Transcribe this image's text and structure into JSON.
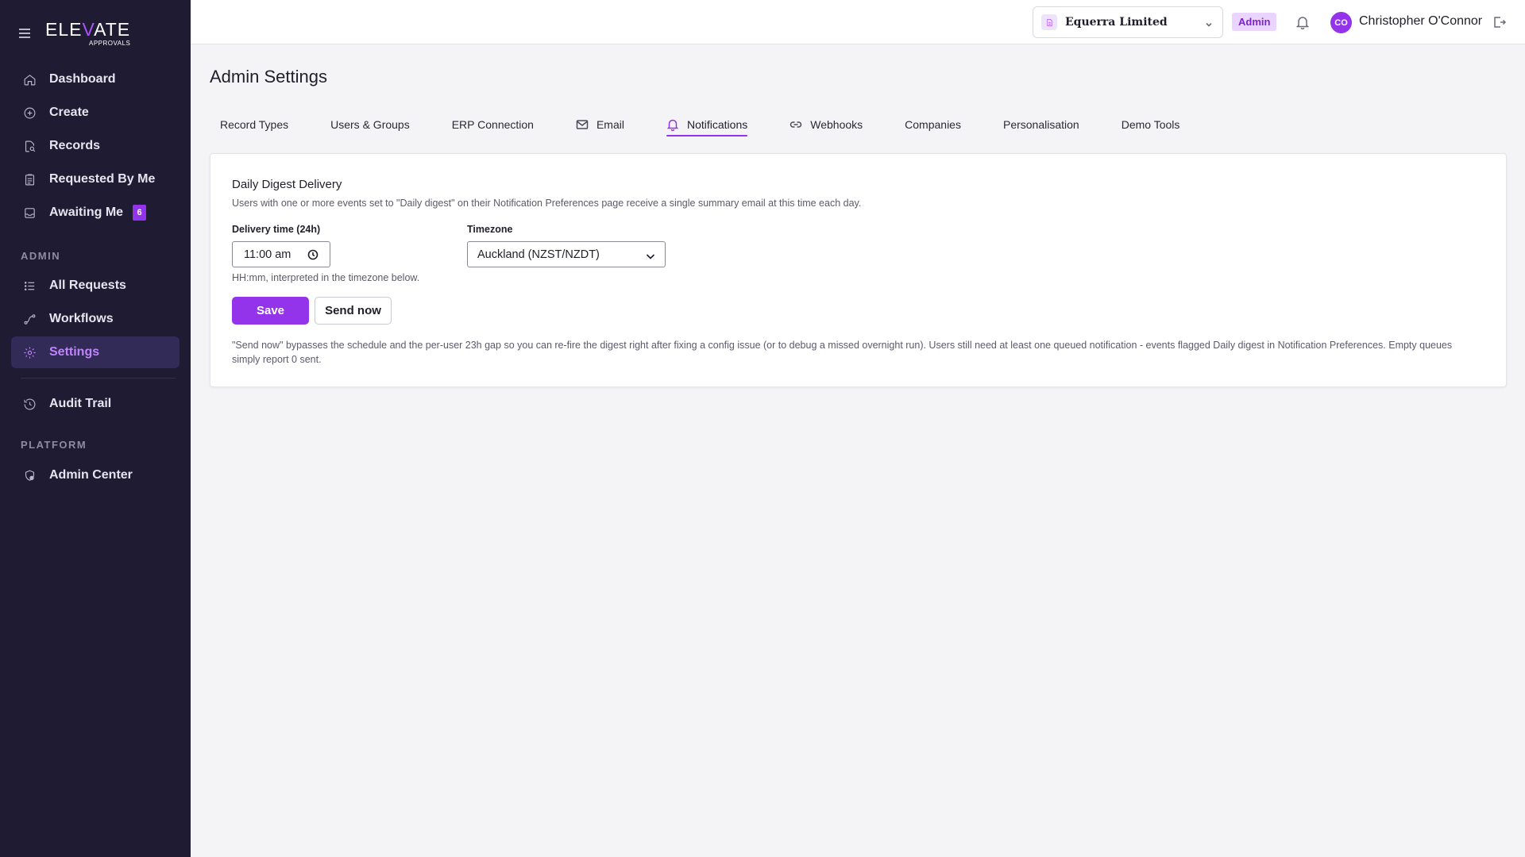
{
  "app": {
    "logo_text_1": "ELE",
    "logo_text_accent": "V",
    "logo_text_2": "ATE",
    "logo_sub": "APPROVALS"
  },
  "sidebar": {
    "items_main": [
      {
        "label": "Dashboard",
        "icon": "home-icon"
      },
      {
        "label": "Create",
        "icon": "plus-circle-icon"
      },
      {
        "label": "Records",
        "icon": "document-search-icon"
      },
      {
        "label": "Requested By Me",
        "icon": "clipboard-icon"
      },
      {
        "label": "Awaiting Me",
        "icon": "inbox-icon",
        "badge": "6"
      }
    ],
    "admin_label": "ADMIN",
    "items_admin": [
      {
        "label": "All Requests",
        "icon": "list-icon"
      },
      {
        "label": "Workflows",
        "icon": "workflow-icon"
      },
      {
        "label": "Settings",
        "icon": "gear-icon",
        "active": true
      }
    ],
    "audit": {
      "label": "Audit Trail",
      "icon": "history-icon"
    },
    "platform_label": "PLATFORM",
    "items_platform": [
      {
        "label": "Admin Center",
        "icon": "shield-settings-icon"
      }
    ]
  },
  "topbar": {
    "company": "Equerra Limited",
    "role": "Admin",
    "user_initials": "CO",
    "user_name": "Christopher O'Connor"
  },
  "page": {
    "title": "Admin Settings",
    "tabs": [
      {
        "label": "Record Types"
      },
      {
        "label": "Users & Groups"
      },
      {
        "label": "ERP Connection"
      },
      {
        "label": "Email",
        "icon": "mail-icon"
      },
      {
        "label": "Notifications",
        "icon": "bell-icon",
        "active": true
      },
      {
        "label": "Webhooks",
        "icon": "link-icon"
      },
      {
        "label": "Companies"
      },
      {
        "label": "Personalisation"
      },
      {
        "label": "Demo Tools"
      }
    ]
  },
  "digest": {
    "title": "Daily Digest Delivery",
    "description": "Users with one or more events set to \"Daily digest\" on their Notification Preferences page receive a single summary email at this time each day.",
    "time_label": "Delivery time (24h)",
    "time_value": "11:00 am",
    "time_hint": "HH:mm, interpreted in the timezone below.",
    "timezone_label": "Timezone",
    "timezone_value": "Auckland (NZST/NZDT)",
    "save_label": "Save",
    "send_now_label": "Send now",
    "note": "\"Send now\" bypasses the schedule and the per-user 23h gap so you can re-fire the digest right after fixing a config issue (or to debug a missed overnight run). Users still need at least one queued notification - events flagged Daily digest in Notification Preferences. Empty queues simply report 0 sent."
  },
  "colors": {
    "sidebar_bg": "#1e1b33",
    "accent": "#9333ea",
    "active_nav_bg": "#322a57"
  }
}
